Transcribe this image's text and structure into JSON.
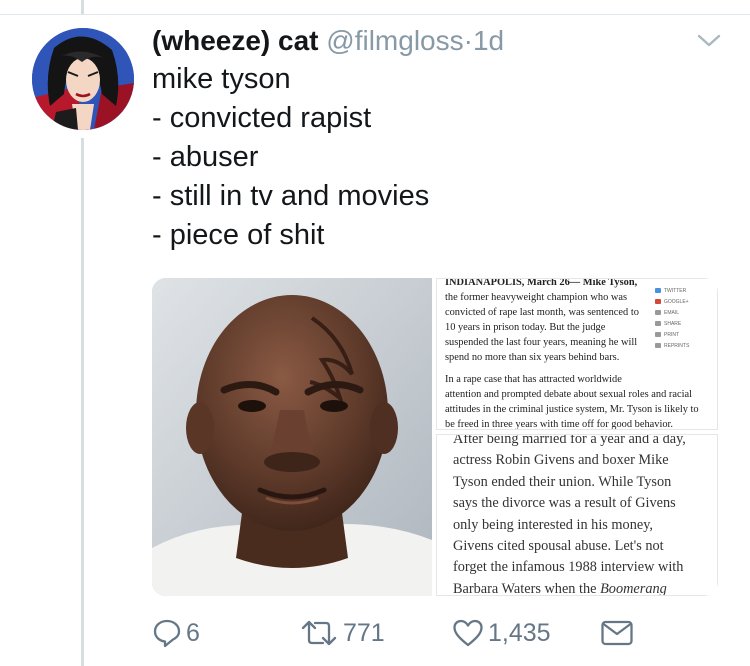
{
  "tweet": {
    "display_name": "(wheeze) cat",
    "handle": "@filmgloss",
    "separator": "·",
    "time": "1d",
    "lines": [
      "mike tyson",
      "- convicted rapist",
      "- abuser",
      "- still in tv and movies",
      "- piece of shit"
    ]
  },
  "media": {
    "article1": {
      "lead": "INDIANAPOLIS, March 26— Mike Tyson,",
      "para1_lines": [
        "the former heavyweight champion who was",
        "convicted of rape last month, was sentenced to",
        "10 years in prison today. But the judge",
        "suspended the last four years, meaning he will",
        "spend no more than six years behind bars."
      ],
      "para2_lines": [
        "In a rape case that has attracted worldwide",
        "attention and prompted debate about sexual roles and racial",
        "attitudes in the criminal justice system, Mr. Tyson is likely to",
        "be freed in three years with time off for good behavior."
      ],
      "share_items": [
        "TWITTER",
        "GOOGLE+",
        "EMAIL",
        "SHARE",
        "PRINT",
        "REPRINTS"
      ]
    },
    "article2": {
      "lines": [
        "After being married for a year and a day,",
        "actress Robin Givens and boxer Mike",
        "Tyson ended their union. While Tyson",
        "says the divorce was a result of Givens",
        "only being interested in his money,",
        "Givens cited spousal abuse. Let's not",
        "forget the infamous 1988 interview with",
        "Barbara Waters when the"
      ],
      "italic_word": "Boomerang"
    }
  },
  "actions": {
    "replies": "6",
    "retweets": "771",
    "likes": "1,435"
  },
  "colors": {
    "text_primary": "#14171a",
    "text_secondary": "#8899a6",
    "action_grey": "#657786"
  }
}
